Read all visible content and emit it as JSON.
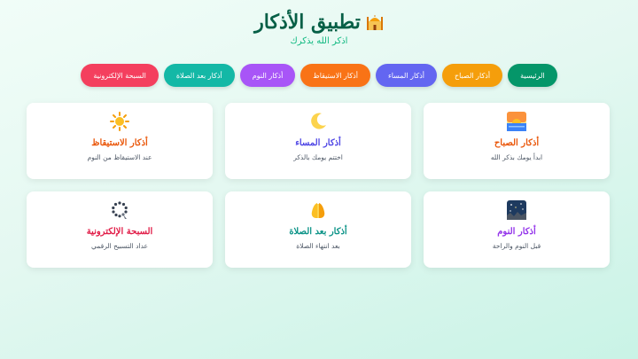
{
  "app": {
    "title": "تطبيق الأذكار",
    "subtitle": "اذكر الله يذكرك"
  },
  "nav": [
    {
      "label": "الرئيسية",
      "color": "#059669"
    },
    {
      "label": "أذكار الصباح",
      "color": "#f59e0b"
    },
    {
      "label": "أذكار المساء",
      "color": "#6366f1"
    },
    {
      "label": "أذكار الاستيقاظ",
      "color": "#f97316"
    },
    {
      "label": "أذكار النوم",
      "color": "#a855f7"
    },
    {
      "label": "أذكار بعد الصلاة",
      "color": "#14b8a6"
    },
    {
      "label": "السبحة الإلكترونية",
      "color": "#f43f5e"
    }
  ],
  "cards": [
    {
      "title": "أذكار الصباح",
      "desc": "ابدأ يومك بذكر الله",
      "color": "#ea580c",
      "icon": "sunrise-icon"
    },
    {
      "title": "أذكار المساء",
      "desc": "اختتم يومك بالذكر",
      "color": "#4f46e5",
      "icon": "crescent-moon-icon"
    },
    {
      "title": "أذكار الاستيقاظ",
      "desc": "عند الاستيقاظ من النوم",
      "color": "#ea580c",
      "icon": "sun-icon"
    },
    {
      "title": "أذكار النوم",
      "desc": "قبل النوم والراحة",
      "color": "#9333ea",
      "icon": "night-sky-icon"
    },
    {
      "title": "أذكار بعد الصلاة",
      "desc": "بعد انتهاء الصلاة",
      "color": "#0d9488",
      "icon": "praying-hands-icon"
    },
    {
      "title": "السبحة الإلكترونية",
      "desc": "عداد التسبيح الرقمي",
      "color": "#e11d48",
      "icon": "prayer-beads-icon"
    }
  ]
}
